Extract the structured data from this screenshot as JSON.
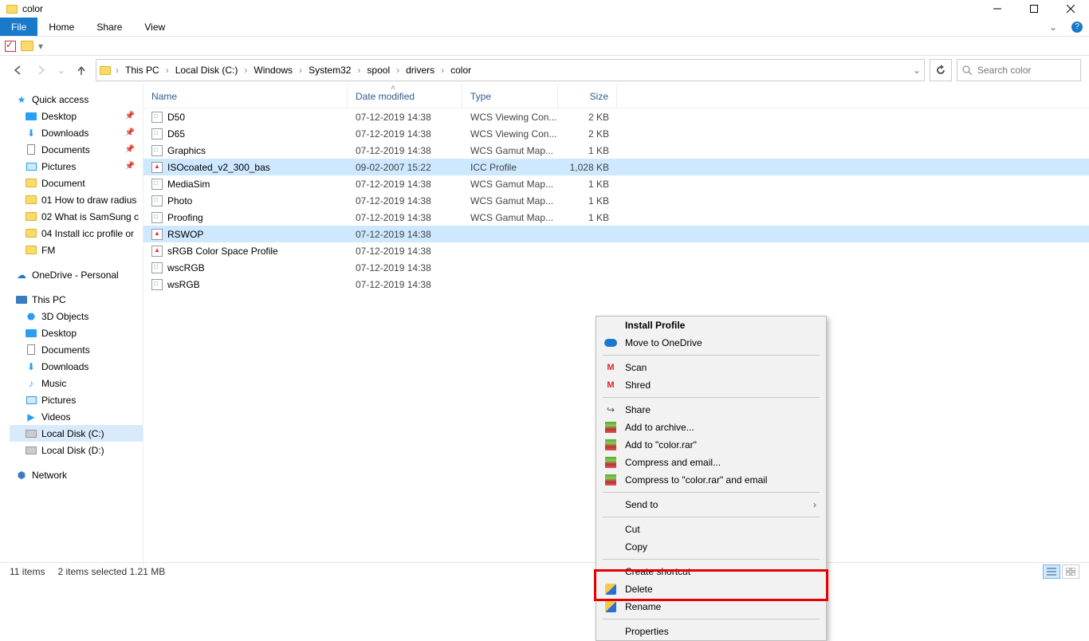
{
  "window": {
    "title": "color"
  },
  "menu": {
    "file": "File",
    "home": "Home",
    "share": "Share",
    "view": "View"
  },
  "breadcrumb": [
    "This PC",
    "Local Disk (C:)",
    "Windows",
    "System32",
    "spool",
    "drivers",
    "color"
  ],
  "search": {
    "placeholder": "Search color"
  },
  "columns": {
    "name": "Name",
    "date": "Date modified",
    "type": "Type",
    "size": "Size"
  },
  "sidebar": {
    "quick": "Quick access",
    "desktop": "Desktop",
    "downloads": "Downloads",
    "documents": "Documents",
    "pictures": "Pictures",
    "doc_folder": "Document",
    "f01": "01 How to draw radius",
    "f02": "02 What is SamSung c",
    "f04": "04 Install icc profile or",
    "fm": "FM",
    "onedrive": "OneDrive - Personal",
    "thispc": "This PC",
    "obj3d": "3D Objects",
    "pc_desktop": "Desktop",
    "pc_documents": "Documents",
    "pc_downloads": "Downloads",
    "music": "Music",
    "pc_pictures": "Pictures",
    "videos": "Videos",
    "diskc": "Local Disk (C:)",
    "diskd": "Local Disk (D:)",
    "network": "Network"
  },
  "files": [
    {
      "name": "D50",
      "date": "07-12-2019 14:38",
      "type": "WCS Viewing Con...",
      "size": "2 KB",
      "ic": "wcs"
    },
    {
      "name": "D65",
      "date": "07-12-2019 14:38",
      "type": "WCS Viewing Con...",
      "size": "2 KB",
      "ic": "wcs"
    },
    {
      "name": "Graphics",
      "date": "07-12-2019 14:38",
      "type": "WCS Gamut Map...",
      "size": "1 KB",
      "ic": "wcs"
    },
    {
      "name": "ISOcoated_v2_300_bas",
      "date": "09-02-2007 15:22",
      "type": "ICC Profile",
      "size": "1,028 KB",
      "ic": "icc",
      "sel": true
    },
    {
      "name": "MediaSim",
      "date": "07-12-2019 14:38",
      "type": "WCS Gamut Map...",
      "size": "1 KB",
      "ic": "wcs"
    },
    {
      "name": "Photo",
      "date": "07-12-2019 14:38",
      "type": "WCS Gamut Map...",
      "size": "1 KB",
      "ic": "wcs"
    },
    {
      "name": "Proofing",
      "date": "07-12-2019 14:38",
      "type": "WCS Gamut Map...",
      "size": "1 KB",
      "ic": "wcs"
    },
    {
      "name": "RSWOP",
      "date": "07-12-2019 14:38",
      "type": "",
      "size": "",
      "ic": "icc",
      "sel": true
    },
    {
      "name": "sRGB Color Space Profile",
      "date": "07-12-2019 14:38",
      "type": "",
      "size": "",
      "ic": "icc"
    },
    {
      "name": "wscRGB",
      "date": "07-12-2019 14:38",
      "type": "",
      "size": "",
      "ic": "wcs"
    },
    {
      "name": "wsRGB",
      "date": "07-12-2019 14:38",
      "type": "",
      "size": "",
      "ic": "wcs"
    }
  ],
  "context": {
    "install": "Install Profile",
    "onedrive": "Move to OneDrive",
    "scan": "Scan",
    "shred": "Shred",
    "share": "Share",
    "archive": "Add to archive...",
    "addrar": "Add to \"color.rar\"",
    "compress": "Compress and email...",
    "compressrar": "Compress to \"color.rar\" and email",
    "sendto": "Send to",
    "cut": "Cut",
    "copy": "Copy",
    "shortcut": "Create shortcut",
    "delete": "Delete",
    "rename": "Rename",
    "properties": "Properties"
  },
  "status": {
    "items": "11 items",
    "selected": "2 items selected  1.21 MB"
  }
}
